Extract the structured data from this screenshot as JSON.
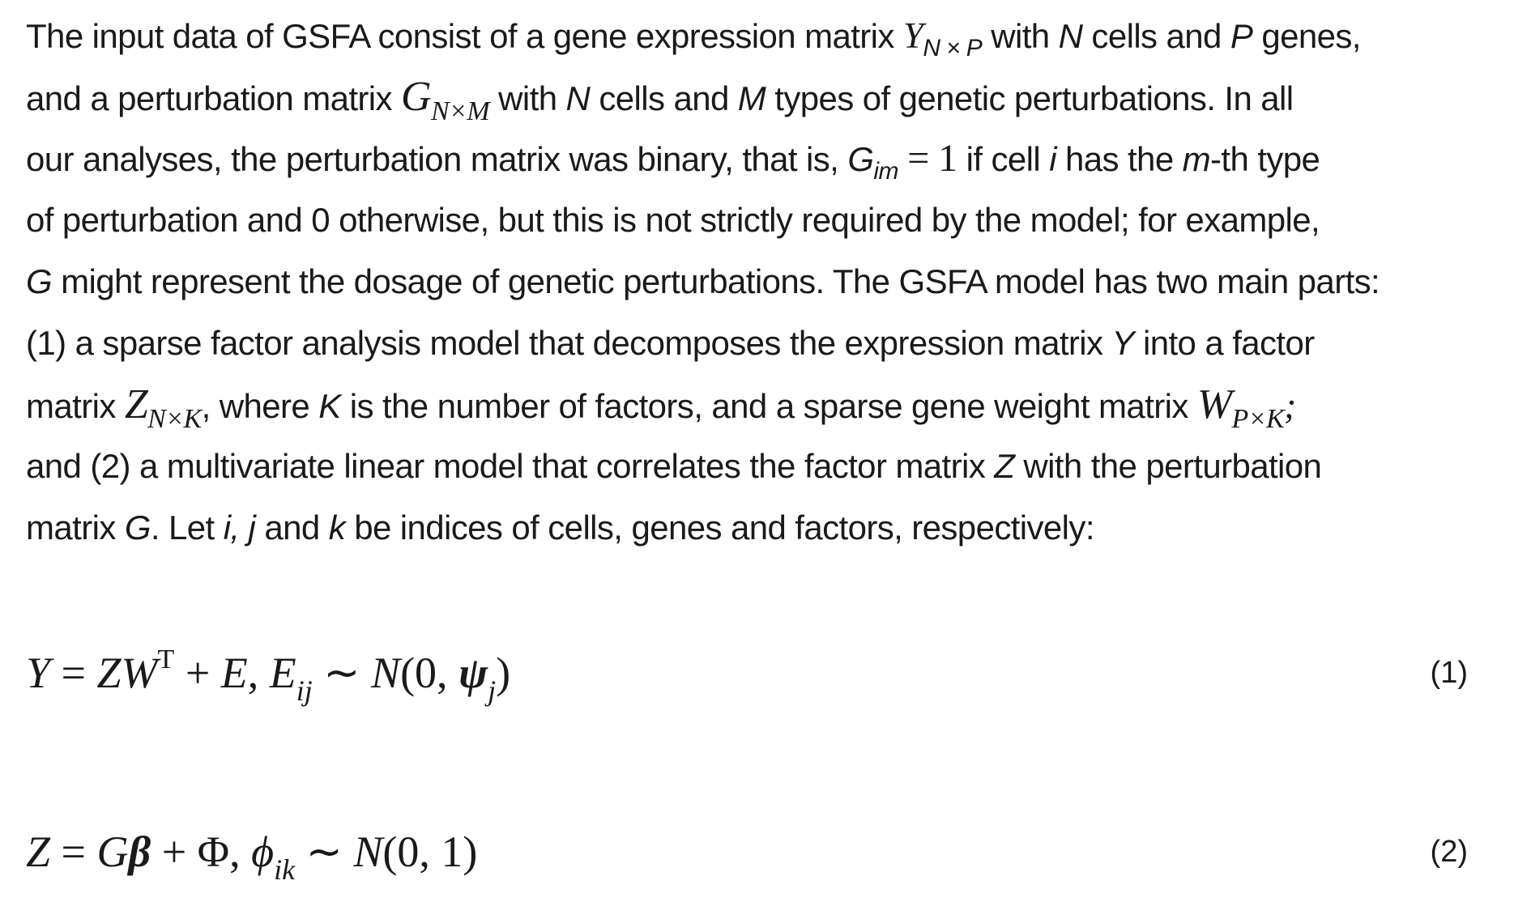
{
  "paragraph": {
    "line1": {
      "a": "The input data of GSFA consist of a gene expression matrix ",
      "Y": "Y",
      "Y_sub": "N × P",
      "b": " with ",
      "N": "N",
      "c": " cells and ",
      "P": "P",
      "d": " genes,"
    },
    "line2": {
      "a": "and a perturbation matrix ",
      "G": "G",
      "G_sub": "N×M",
      "b": " with ",
      "N": "N",
      "c": " cells and ",
      "M": "M",
      "d": " types of genetic perturbations. In all"
    },
    "line3": {
      "a": "our analyses, the perturbation matrix was binary, that is, ",
      "G": "G",
      "G_sub": "im",
      "eq": " = ",
      "one": "1",
      "b": " if cell ",
      "i": "i",
      "c": " has the ",
      "m": "m",
      "d": "-th type"
    },
    "line4": {
      "a": "of perturbation and 0 otherwise, but this is not strictly required by the model; for example,"
    },
    "line5": {
      "G": "G",
      "a": " might represent the dosage of genetic perturbations. The GSFA model has two main parts:"
    },
    "line6": {
      "a": "(1) a sparse factor analysis model that decomposes the expression matrix ",
      "Y": "Y",
      "b": " into a factor"
    },
    "line7": {
      "a": "matrix ",
      "Z": "Z",
      "Z_sub": "N×K",
      "b": ", where ",
      "K": "K",
      "c": " is the number of factors, and a sparse gene weight matrix ",
      "W": "W",
      "W_sub": "P×K",
      "d": ";"
    },
    "line8": {
      "a": "and (2) a multivariate linear model that correlates the factor matrix ",
      "Z": "Z",
      "b": " with the perturbation"
    },
    "line9": {
      "a": "matrix ",
      "G": "G",
      "b": ". Let ",
      "ij": "i, j",
      "c": " and ",
      "k": "k",
      "d": " be indices of cells, genes and factors, respectively:"
    }
  },
  "equations": [
    {
      "number": "(1)",
      "Y": "Y",
      "eq": " = ",
      "ZW": "ZW",
      "T": "T",
      "plus": " + ",
      "E": "E",
      "comma": ", ",
      "E2": "E",
      "E_sub": "ij",
      "sim": " ∼ ",
      "N": "N",
      "open": "(0, ",
      "psi": "ψ",
      "psi_sub": "j",
      "close": ")"
    },
    {
      "number": "(2)",
      "Z": "Z",
      "eq": " = ",
      "G": "G",
      "beta": "β",
      "plus": " + ",
      "Phi": "Φ",
      "comma": ", ",
      "phi": "ϕ",
      "phi_sub": "ik",
      "sim": " ∼ ",
      "N": "N",
      "args": "(0, 1)"
    }
  ]
}
